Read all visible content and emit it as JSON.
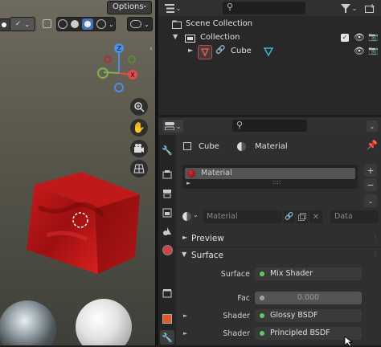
{
  "viewport": {
    "options_label": "Options"
  },
  "outliner": {
    "rows": [
      {
        "label": "Scene Collection"
      },
      {
        "label": "Collection"
      },
      {
        "label": "Cube"
      }
    ]
  },
  "properties": {
    "breadcrumb": {
      "object": "Cube",
      "material": "Material"
    },
    "slot": {
      "name": "Material"
    },
    "material_field": {
      "name": "Material",
      "link": "Data"
    },
    "panels": {
      "preview": "Preview",
      "surface": "Surface"
    },
    "surface_rows": [
      {
        "label": "Surface",
        "value": "Mix Shader"
      },
      {
        "label": "Fac",
        "value": "0.000"
      },
      {
        "label": "Shader",
        "value": "Glossy BSDF"
      },
      {
        "label": "Shader",
        "value": "Principled BSDF"
      }
    ]
  },
  "colors": {
    "accent_blue": "#4772b3",
    "x_axis": "#e64b4b",
    "y_axis": "#7fb34b",
    "z_axis": "#4b8ee6",
    "socket_green": "#63c763"
  }
}
